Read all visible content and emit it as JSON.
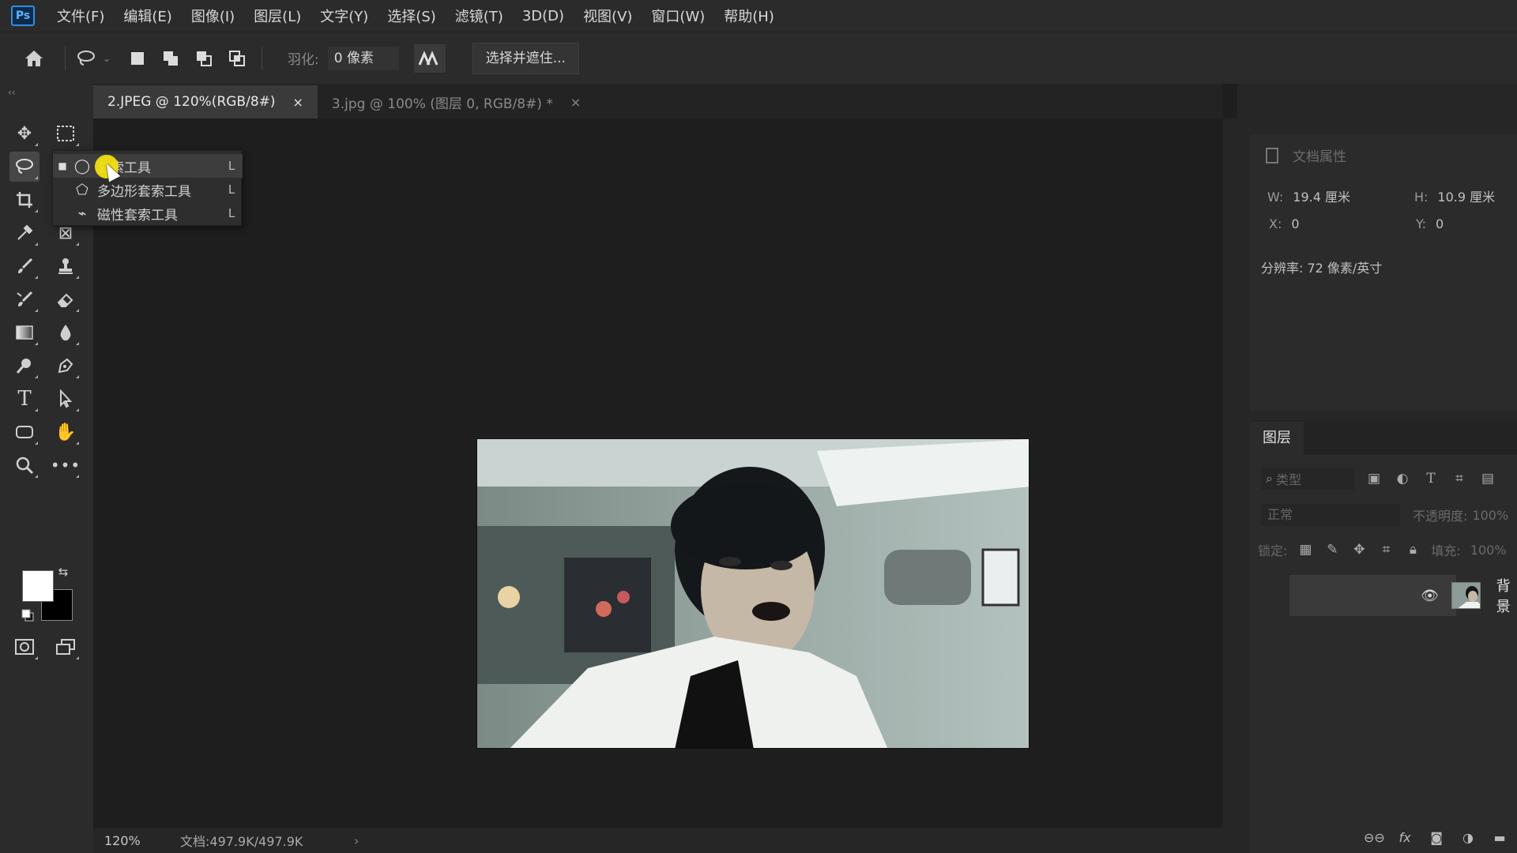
{
  "app": {
    "logo": "Ps"
  },
  "menu": [
    "文件(F)",
    "编辑(E)",
    "图像(I)",
    "图层(L)",
    "文字(Y)",
    "选择(S)",
    "滤镜(T)",
    "3D(D)",
    "视图(V)",
    "窗口(W)",
    "帮助(H)"
  ],
  "options": {
    "feather_label": "羽化:",
    "feather_value": "0 像素",
    "select_mask_label": "选择并遮住..."
  },
  "tabs": [
    {
      "label": "2.JPEG @ 120%(RGB/8#)",
      "close": "×",
      "active": true
    },
    {
      "label": "3.jpg @ 100% (图层 0, RGB/8#) *",
      "close": "×",
      "active": false
    }
  ],
  "flyout": {
    "items": [
      {
        "label": "套索工具",
        "key": "L",
        "checked": true
      },
      {
        "label": "多边形套索工具",
        "key": "L",
        "checked": false
      },
      {
        "label": "磁性套索工具",
        "key": "L",
        "checked": false
      }
    ]
  },
  "properties": {
    "title": "文档属性",
    "w_label": "W:",
    "w_value": "19.4 厘米",
    "h_label": "H:",
    "h_value": "10.9 厘米",
    "x_label": "X:",
    "x_value": "0",
    "y_label": "Y:",
    "y_value": "0",
    "resolution": "分辨率: 72 像素/英寸"
  },
  "layers": {
    "tab": "图层",
    "search_placeholder": "类型",
    "blend_mode": "正常",
    "opacity_label": "不透明度:",
    "opacity_value": "100%",
    "lock_label": "锁定:",
    "fill_label": "填充:",
    "fill_value": "100%",
    "items": [
      {
        "name": "背景"
      }
    ]
  },
  "status": {
    "zoom": "120%",
    "doc": "文档:497.9K/497.9K",
    "arrow": "›"
  },
  "colors": {
    "foreground": "#ffffff",
    "background": "#000000",
    "accent": "#2f8fe3"
  }
}
